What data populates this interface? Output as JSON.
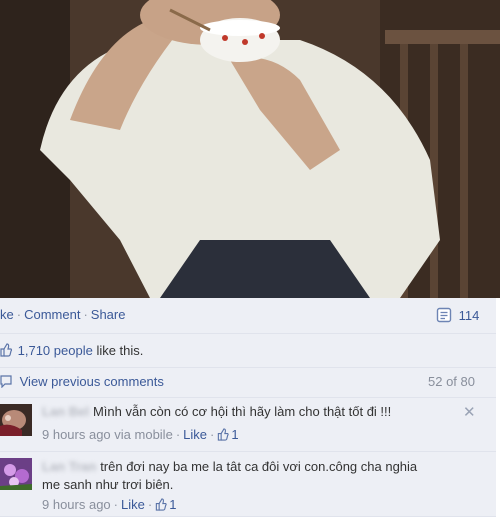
{
  "post_actions": {
    "like_label": "ke",
    "comment_label": "Comment",
    "share_label": "Share",
    "share_count": "114"
  },
  "likes": {
    "count": "1,710 people",
    "suffix": "like this."
  },
  "comments_header": {
    "view_previous_label": "View previous comments",
    "position": "52 of 80"
  },
  "comments": [
    {
      "author": "Lan Bel",
      "text": "Mình vẫn còn có cơ hội thì hãy làm cho thật tốt đi !!!",
      "time": "9 hours ago via mobile",
      "like_label": "Like",
      "like_count": "1",
      "close_glyph": "✕"
    },
    {
      "author": "Lan Tran",
      "text_line1": "trên đơi nay ba me la tât ca đôi vơi con.công cha nghia",
      "text_line2": "me sanh như trơi biên.",
      "time": "9 hours ago",
      "like_label": "Like",
      "like_count": "1"
    }
  ],
  "icons": {
    "share_icon": "share-count-icon",
    "thumb_icon": "thumbs-up-icon",
    "comment_icon": "comment-bubble-icon",
    "close_icon": "close-icon"
  },
  "colors": {
    "link": "#3b5998",
    "strip_bg": "#edeff5",
    "muted": "#898f9c"
  }
}
